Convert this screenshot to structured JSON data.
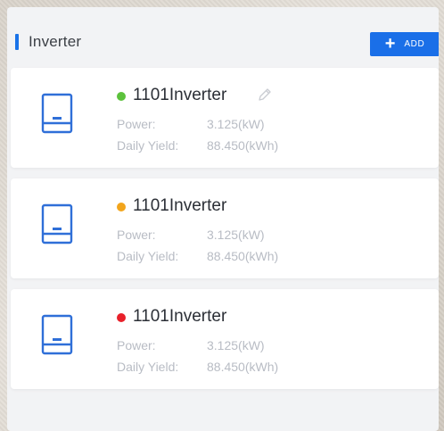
{
  "section": {
    "title": "Inverter",
    "accent_color": "#1a73e8"
  },
  "add_button": {
    "icon": "plus-icon",
    "label": "ADD",
    "color": "#1a6fe8"
  },
  "inverters": [
    {
      "name": "1101Inverter",
      "status_color": "#5cc23c",
      "show_edit": true,
      "power_label": "Power:",
      "power_value": "3.125(kW)",
      "yield_label": "Daily Yield:",
      "yield_value": "88.450(kWh)",
      "icon": "inverter-icon"
    },
    {
      "name": "1101Inverter",
      "status_color": "#f2a51c",
      "show_edit": false,
      "power_label": "Power:",
      "power_value": "3.125(kW)",
      "yield_label": "Daily Yield:",
      "yield_value": "88.450(kWh)",
      "icon": "inverter-icon"
    },
    {
      "name": "1101Inverter",
      "status_color": "#e8202a",
      "show_edit": false,
      "power_label": "Power:",
      "power_value": "3.125(kW)",
      "yield_label": "Daily Yield:",
      "yield_value": "88.450(kWh)",
      "icon": "inverter-icon"
    }
  ]
}
